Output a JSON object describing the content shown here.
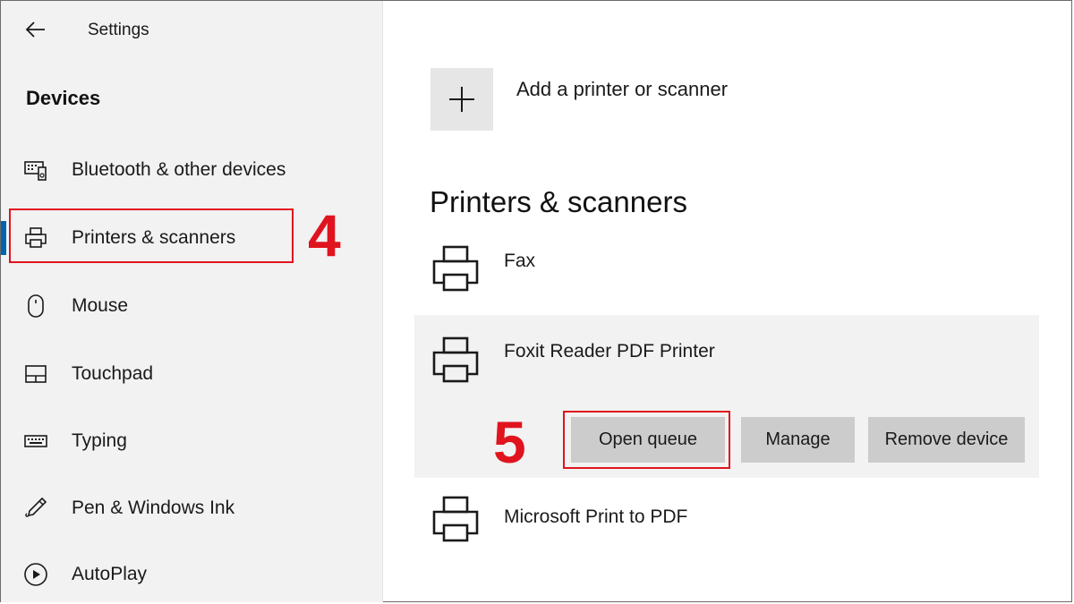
{
  "window": {
    "title": "Settings",
    "back_icon": "arrow-left-icon"
  },
  "sidebar": {
    "section_title": "Devices",
    "accent_color": "#0063b1",
    "items": [
      {
        "label": "Bluetooth & other devices",
        "icon": "bluetooth-devices-icon",
        "selected": false
      },
      {
        "label": "Printers & scanners",
        "icon": "printer-icon",
        "selected": true
      },
      {
        "label": "Mouse",
        "icon": "mouse-icon",
        "selected": false
      },
      {
        "label": "Touchpad",
        "icon": "touchpad-icon",
        "selected": false
      },
      {
        "label": "Typing",
        "icon": "keyboard-icon",
        "selected": false
      },
      {
        "label": "Pen & Windows Ink",
        "icon": "pen-icon",
        "selected": false
      },
      {
        "label": "AutoPlay",
        "icon": "autoplay-icon",
        "selected": false
      }
    ]
  },
  "main": {
    "add_label": "Add a printer or scanner",
    "add_icon": "plus-icon",
    "heading": "Printers & scanners",
    "printers": [
      {
        "name": "Fax",
        "icon": "printer-icon",
        "expanded": false
      },
      {
        "name": "Foxit Reader PDF Printer",
        "icon": "printer-icon",
        "expanded": true,
        "actions": [
          "Open queue",
          "Manage",
          "Remove device"
        ]
      },
      {
        "name": "Microsoft Print to PDF",
        "icon": "printer-icon",
        "expanded": false
      }
    ]
  },
  "annotations": {
    "step4": "4",
    "step5": "5",
    "highlight_color": "#e0141e"
  }
}
